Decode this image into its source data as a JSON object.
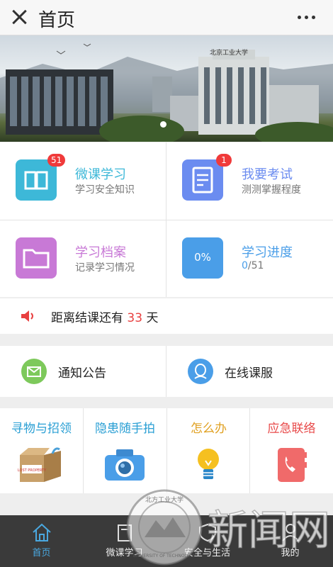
{
  "header": {
    "title": "首页"
  },
  "banner": {
    "sign_text": "北京工业大学"
  },
  "tiles": [
    {
      "title": "微课学习",
      "subtitle": "学习安全知识",
      "badge": "51",
      "color": "#3db8d8",
      "icon": "book-icon"
    },
    {
      "title": "我要考试",
      "subtitle": "测测掌握程度",
      "badge": "1",
      "color": "#6b8cf0",
      "icon": "exam-paper-icon"
    },
    {
      "title": "学习档案",
      "subtitle": "记录学习情况",
      "color": "#c879d6",
      "icon": "folder-icon"
    },
    {
      "title": "学习进度",
      "progress_pct": "0%",
      "progress_done": "0",
      "progress_total": "/51",
      "color": "#4a9ee8",
      "icon": "progress-icon"
    }
  ],
  "countdown": {
    "prefix": "距离结课还有",
    "days": "33",
    "suffix": "天"
  },
  "links": [
    {
      "label": "通知公告",
      "color": "#7dc95b",
      "icon": "mail-icon"
    },
    {
      "label": "在线课服",
      "color": "#4a9ee8",
      "icon": "customer-service-icon"
    }
  ],
  "quick": [
    {
      "label": "寻物与招领",
      "color": "#2a9fd4",
      "icon": "lost-property-box-icon",
      "box_text": "LOST PROPERTY"
    },
    {
      "label": "隐患随手拍",
      "color": "#2a9fd4",
      "icon": "camera-icon"
    },
    {
      "label": "怎么办",
      "color": "#e0a020",
      "icon": "lightbulb-icon"
    },
    {
      "label": "应急联络",
      "color": "#e84a4a",
      "icon": "phone-book-icon"
    }
  ],
  "tabbar": [
    {
      "label": "首页",
      "active": true
    },
    {
      "label": "微课学习"
    },
    {
      "label": "安全与生活"
    },
    {
      "label": "我的"
    }
  ],
  "watermark": {
    "text": "新闻网",
    "seal_top": "北方工业大学",
    "seal_bottom": "UNIVERSITY OF TECHNOLOGY"
  },
  "colors": {
    "accent": "#4aa8e0",
    "badge": "#f03a3a",
    "countdown_number": "#e84040"
  }
}
